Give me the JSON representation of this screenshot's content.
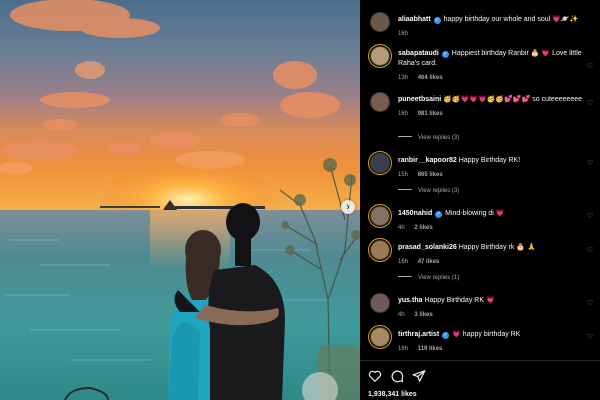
{
  "post": {
    "likes_count": "1,938,341 likes"
  },
  "comments": [
    {
      "username": "aliaabhatt",
      "verified": true,
      "text": "happy birthday our whole and soul 💗🪐✨",
      "time": "16h",
      "likes": "",
      "replies": ""
    },
    {
      "username": "sabapataudi",
      "verified": true,
      "text": "Happiest birthday Ranbir 🎂 💗 Love little Raha's card.",
      "time": "13h",
      "likes": "464 likes",
      "replies": ""
    },
    {
      "username": "puneetbsaini",
      "verified": false,
      "text": "🥳🥳💗💗💗🥳🥳💕💕💕 so cuteeeeeeee",
      "time": "16h",
      "likes": "981 likes",
      "replies": "View replies (3)"
    },
    {
      "username": "ranbir__kapoor82",
      "verified": false,
      "text": "Happy Birthday RK!",
      "time": "15h",
      "likes": "865 likes",
      "replies": "View replies (3)"
    },
    {
      "username": "1450nahid",
      "verified": true,
      "text": "Mind-blowing di 💗",
      "time": "4h",
      "likes": "2 likes",
      "replies": ""
    },
    {
      "username": "prasad_solanki26",
      "verified": false,
      "text": "Happy Birthday rk 🎂 🙏",
      "time": "16h",
      "likes": "47 likes",
      "replies": "View replies (1)"
    },
    {
      "username": "yus.tha",
      "verified": false,
      "text": "Happy Birthday RK 💗",
      "time": "4h",
      "likes": "3 likes",
      "replies": ""
    },
    {
      "username": "tirthraj.artist",
      "verified": true,
      "text": "💗 happy birthday RK",
      "time": "16h",
      "likes": "119 likes",
      "replies": ""
    }
  ],
  "icons": {
    "verified": "✓",
    "next": "›",
    "comment_like": "♡"
  },
  "colors": {
    "background": "#000000",
    "verified_badge": "#3897f0",
    "meta_text": "#a8a8a8",
    "story_ring": "#d8a21a"
  }
}
